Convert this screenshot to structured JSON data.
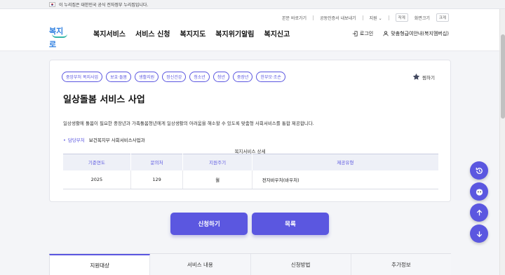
{
  "gov_banner": {
    "text": "이 누리집은 대한민국 공식 전자정부 누리집입니다."
  },
  "util_links": {
    "skip": "본문 바로가기",
    "cert": "공동인증서 내보내기",
    "region": "지원",
    "region_arrow": "⌄",
    "small_label": "작게",
    "zoom_label": "화면크기",
    "large_label": "크게"
  },
  "logo": {
    "text": "복지로"
  },
  "gnb": [
    "복지서비스",
    "서비스 신청",
    "복지지도",
    "복지위기알림",
    "복지신고"
  ],
  "header_right": {
    "login": "로그인",
    "benefit": "맞춤형급여안내(복지멤버십)"
  },
  "service": {
    "tags": [
      "중앙부처 복지사업",
      "보호·돌봄",
      "생활지원",
      "정신건강",
      "청소년",
      "청년",
      "중장년",
      "한부모·조손"
    ],
    "favorite": "찜하기",
    "title": "일상돌봄 서비스 사업",
    "description": "일상생활에 돌봄이 필요한 중장년과 가족돌봄청년에게 일상생활의 어려움을 해소할 수 있도록 맞춤형 사회서비스를 통합 제공합니다.",
    "dept_label": "담당부처",
    "dept_value": "보건복지부 사회서비스사업과",
    "table_caption": "복지서비스 상세",
    "table_headers": [
      "기준연도",
      "문의처",
      "지원주기",
      "제공유형"
    ],
    "table_row": [
      "2025",
      "129",
      "월",
      "전자바우처(바우처)"
    ]
  },
  "buttons": {
    "apply": "신청하기",
    "list": "목록"
  },
  "floating": [
    "refresh-icon",
    "chatbot-icon",
    "arrow-up-icon",
    "arrow-down-icon"
  ],
  "tabs": [
    "지원대상",
    "서비스 내용",
    "신청방법",
    "추가정보"
  ],
  "colors": {
    "accent": "#5b57e0",
    "logo": "#2f7fe0"
  }
}
